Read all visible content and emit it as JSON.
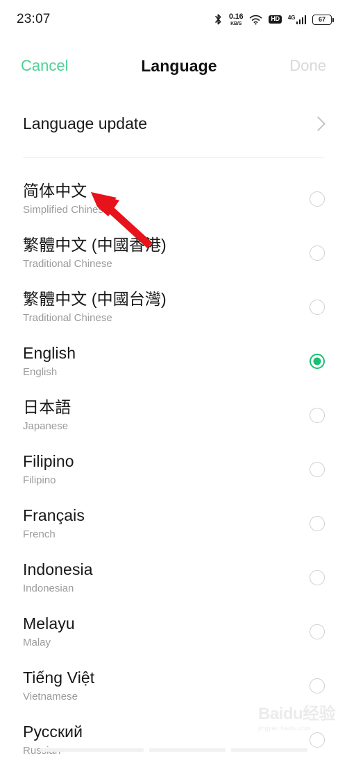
{
  "status_bar": {
    "clock": "23:07",
    "bluetooth_icon": "bluetooth-icon",
    "network_speed_value": "0.16",
    "network_speed_unit": "KB/S",
    "wifi_icon": "wifi-icon",
    "hd_badge": "HD",
    "signal_label": "4G",
    "battery_level": "67"
  },
  "header": {
    "cancel_label": "Cancel",
    "title": "Language",
    "done_label": "Done",
    "cancel_color": "#4ed193",
    "done_color": "#d8d8d8"
  },
  "update_row": {
    "label": "Language update",
    "chevron_icon": "chevron-right-icon"
  },
  "languages": [
    {
      "native": "简体中文",
      "english": "Simplified Chinese",
      "selected": false
    },
    {
      "native": "繁體中文 (中國香港)",
      "english": "Traditional Chinese",
      "selected": false
    },
    {
      "native": "繁體中文 (中國台灣)",
      "english": "Traditional Chinese",
      "selected": false
    },
    {
      "native": "English",
      "english": "English",
      "selected": true
    },
    {
      "native": "日本語",
      "english": "Japanese",
      "selected": false
    },
    {
      "native": "Filipino",
      "english": "Filipino",
      "selected": false
    },
    {
      "native": "Français",
      "english": "French",
      "selected": false
    },
    {
      "native": "Indonesia",
      "english": "Indonesian",
      "selected": false
    },
    {
      "native": "Melayu",
      "english": "Malay",
      "selected": false
    },
    {
      "native": "Tiếng Việt",
      "english": "Vietnamese",
      "selected": false
    },
    {
      "native": "Русский",
      "english": "Russian",
      "selected": false
    }
  ],
  "annotation": {
    "arrow_color": "#e8121a",
    "arrow_description": "red-arrow pointing to 简体中文"
  },
  "watermark": {
    "main": "Baidu经验",
    "sub": "jingyan.baidu.com"
  },
  "theme": {
    "accent_green": "#17c074",
    "background": "#ffffff",
    "primary_text": "#171717",
    "secondary_text": "#9b9b9b"
  }
}
